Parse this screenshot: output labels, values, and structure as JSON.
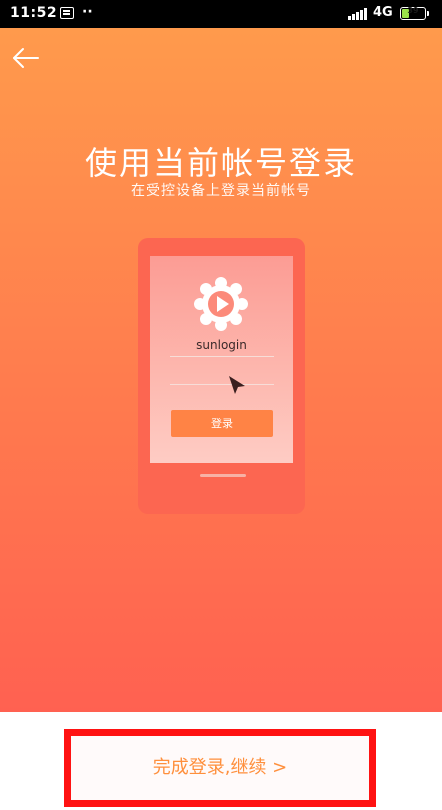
{
  "status_bar": {
    "time": "11:52",
    "dots": "··",
    "network": "4G",
    "battery_level": "39"
  },
  "header": {
    "back_icon": "back-arrow-icon"
  },
  "hero": {
    "title": "使用当前帐号登录",
    "subtitle": "在受控设备上登录当前帐号"
  },
  "illustration": {
    "logo_icon": "sunlogin-logo-icon",
    "app_name": "sunlogin",
    "cursor_icon": "mouse-pointer-icon",
    "login_label": "登录"
  },
  "footer": {
    "continue_label": "完成登录,继续 >"
  },
  "colors": {
    "gradient_top": "#ff9a4c",
    "gradient_bottom": "#ff6151",
    "phone_body": "#fc6651",
    "accent_button": "#ff8345",
    "continue_text": "#ff8f3c",
    "highlight_border": "#ff1212"
  }
}
